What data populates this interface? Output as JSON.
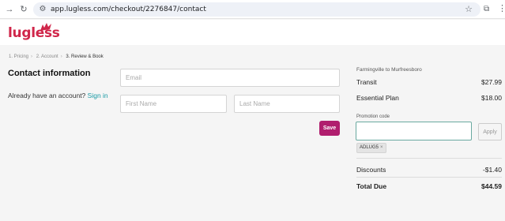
{
  "browser": {
    "url": "app.lugless.com/checkout/2276847/contact"
  },
  "site": {
    "logo_text": "lugless"
  },
  "breadcrumb": [
    {
      "label": "1. Pricing"
    },
    {
      "label": "2. Account"
    },
    {
      "label": "3. Review & Book"
    }
  ],
  "form": {
    "heading": "Contact information",
    "account_prompt": "Already have an account?",
    "sign_in_link": "Sign in",
    "email_placeholder": "Email",
    "email_value": "",
    "first_name_placeholder": "First Name",
    "first_name_value": "",
    "last_name_placeholder": "Last Name",
    "last_name_value": "",
    "save_label": "Save"
  },
  "summary": {
    "route": "Farmingville to Murfreesboro",
    "items": [
      {
        "label": "Transit",
        "amount": "$27.99"
      },
      {
        "label": "Essential Plan",
        "amount": "$18.00"
      }
    ],
    "promo_label": "Promotion code",
    "promo_value": "",
    "apply_label": "Apply",
    "applied_code": "ADLUG5",
    "remove_symbol": "×",
    "discounts_label": "Discounts",
    "discounts_amount": "-$1.40",
    "total_label": "Total Due",
    "total_amount": "$44.59"
  },
  "colors": {
    "brand": "#d0264a",
    "save_button": "#b01e6e",
    "link": "#1a9ba5",
    "promo_focus": "#6aa9a0"
  }
}
